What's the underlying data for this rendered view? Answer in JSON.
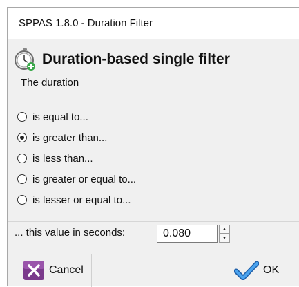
{
  "window": {
    "title": "SPPAS 1.8.0  - Duration Filter"
  },
  "header": {
    "title": "Duration-based single filter",
    "icon": "stopwatch-add-icon"
  },
  "duration_group": {
    "legend": "The duration",
    "options": [
      {
        "label": "is equal to...",
        "checked": false
      },
      {
        "label": "is greater than...",
        "checked": true
      },
      {
        "label": "is less than...",
        "checked": false
      },
      {
        "label": "is greater or equal to...",
        "checked": false
      },
      {
        "label": "is lesser or equal to...",
        "checked": false
      }
    ]
  },
  "value": {
    "label": "... this value in seconds:",
    "current": "0.080"
  },
  "buttons": {
    "cancel_label": "Cancel",
    "ok_label": "OK"
  },
  "colors": {
    "cancel_icon": "#7b3a8c",
    "ok_icon": "#2f7fd6",
    "window_bg": "#f0f0f0"
  }
}
